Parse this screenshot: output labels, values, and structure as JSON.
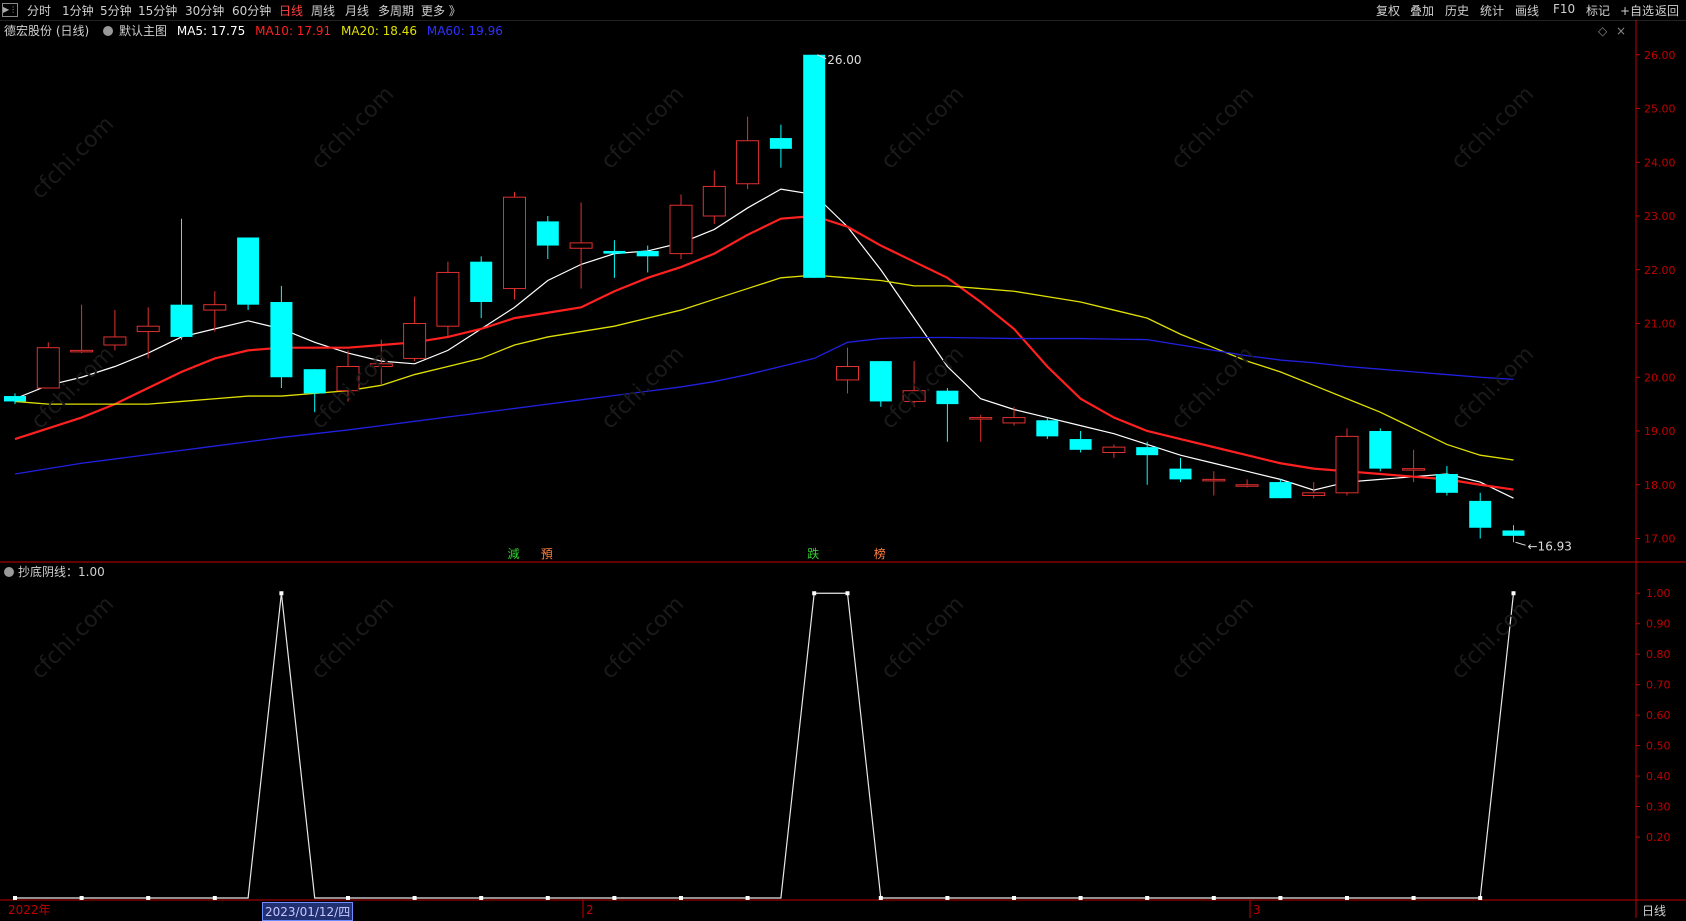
{
  "toolbar": {
    "left": [
      "分时",
      "1分钟",
      "5分钟",
      "15分钟",
      "30分钟",
      "60分钟",
      "日线",
      "周线",
      "月线",
      "多周期",
      "更多 》"
    ],
    "active": "日线",
    "right": [
      "复权",
      "叠加",
      "历史",
      "统计",
      "画线",
      "F10",
      "标记",
      "+自选",
      "返回"
    ]
  },
  "info": {
    "stock": "德宏股份 (日线)",
    "template": "默认主图",
    "ma5": "MA5: 17.75",
    "ma10": "MA10: 17.91",
    "ma20": "MA20: 18.46",
    "ma60": "MA60: 19.96"
  },
  "sub_indicator": {
    "label": "抄底阴线：1.00"
  },
  "x_labels": {
    "year": "2022年",
    "date_cursor": "2023/01/12/四",
    "m2": "2",
    "m3": "3"
  },
  "period": "日线",
  "colors": {
    "up": "#e03030",
    "down": "#00ffff",
    "ma5": "#ffffff",
    "ma10": "#ff2020",
    "ma20": "#e0e000",
    "ma60": "#2020e0",
    "axis": "#c00000"
  },
  "chart_data": [
    {
      "type": "candlestick",
      "title": "德宏股份 (日线)",
      "ylim": [
        16.6,
        26.2
      ],
      "y_ticks": [
        "26.00",
        "25.00",
        "24.00",
        "23.00",
        "22.00",
        "21.00",
        "20.00",
        "19.00",
        "18.00",
        "17.00"
      ],
      "max_label": "26.00",
      "min_label": "16.93",
      "candles": [
        {
          "o": 19.65,
          "c": 19.55,
          "h": 19.7,
          "l": 19.5
        },
        {
          "o": 19.8,
          "c": 20.55,
          "h": 20.65,
          "l": 19.8
        },
        {
          "o": 20.5,
          "c": 20.5,
          "h": 21.35,
          "l": 20.45
        },
        {
          "o": 20.6,
          "c": 20.75,
          "h": 21.25,
          "l": 20.5
        },
        {
          "o": 20.85,
          "c": 20.95,
          "h": 21.3,
          "l": 20.35
        },
        {
          "o": 21.35,
          "c": 20.75,
          "h": 22.95,
          "l": 20.7
        },
        {
          "o": 21.25,
          "c": 21.35,
          "h": 21.6,
          "l": 20.85
        },
        {
          "o": 22.6,
          "c": 21.35,
          "h": 22.6,
          "l": 21.25
        },
        {
          "o": 21.4,
          "c": 20.0,
          "h": 21.7,
          "l": 19.8
        },
        {
          "o": 20.15,
          "c": 19.7,
          "h": 20.15,
          "l": 19.35
        },
        {
          "o": 19.75,
          "c": 20.2,
          "h": 20.5,
          "l": 19.55
        },
        {
          "o": 20.2,
          "c": 20.25,
          "h": 20.7,
          "l": 19.85
        },
        {
          "o": 20.35,
          "c": 21.0,
          "h": 21.5,
          "l": 20.3
        },
        {
          "o": 20.95,
          "c": 21.95,
          "h": 22.15,
          "l": 20.75
        },
        {
          "o": 22.15,
          "c": 21.4,
          "h": 22.25,
          "l": 21.1
        },
        {
          "o": 21.65,
          "c": 23.35,
          "h": 23.45,
          "l": 21.45
        },
        {
          "o": 22.9,
          "c": 22.45,
          "h": 23.0,
          "l": 22.2
        },
        {
          "o": 22.4,
          "c": 22.5,
          "h": 23.25,
          "l": 21.65
        },
        {
          "o": 22.35,
          "c": 22.3,
          "h": 22.55,
          "l": 21.85
        },
        {
          "o": 22.35,
          "c": 22.25,
          "h": 22.45,
          "l": 21.95
        },
        {
          "o": 22.3,
          "c": 23.2,
          "h": 23.4,
          "l": 22.2
        },
        {
          "o": 23.0,
          "c": 23.55,
          "h": 23.85,
          "l": 22.85
        },
        {
          "o": 23.6,
          "c": 24.4,
          "h": 24.85,
          "l": 23.5
        },
        {
          "o": 24.45,
          "c": 24.25,
          "h": 24.7,
          "l": 23.9
        },
        {
          "o": 26.0,
          "c": 21.85,
          "h": 26.0,
          "l": 21.85
        },
        {
          "o": 19.95,
          "c": 20.2,
          "h": 20.55,
          "l": 19.7
        },
        {
          "o": 20.3,
          "c": 19.55,
          "h": 20.3,
          "l": 19.45
        },
        {
          "o": 19.55,
          "c": 19.75,
          "h": 20.3,
          "l": 19.45
        },
        {
          "o": 19.75,
          "c": 19.5,
          "h": 19.8,
          "l": 18.8
        },
        {
          "o": 19.25,
          "c": 19.25,
          "h": 19.3,
          "l": 18.8
        },
        {
          "o": 19.15,
          "c": 19.25,
          "h": 19.45,
          "l": 19.1
        },
        {
          "o": 19.2,
          "c": 18.9,
          "h": 19.25,
          "l": 18.85
        },
        {
          "o": 18.85,
          "c": 18.65,
          "h": 19.0,
          "l": 18.6
        },
        {
          "o": 18.6,
          "c": 18.7,
          "h": 18.75,
          "l": 18.5
        },
        {
          "o": 18.7,
          "c": 18.55,
          "h": 18.8,
          "l": 18.0
        },
        {
          "o": 18.3,
          "c": 18.1,
          "h": 18.5,
          "l": 18.05
        },
        {
          "o": 18.1,
          "c": 18.1,
          "h": 18.25,
          "l": 17.8
        },
        {
          "o": 18.0,
          "c": 18.0,
          "h": 18.1,
          "l": 17.95
        },
        {
          "o": 18.05,
          "c": 17.75,
          "h": 18.1,
          "l": 17.75
        },
        {
          "o": 17.8,
          "c": 17.85,
          "h": 18.05,
          "l": 17.75
        },
        {
          "o": 17.85,
          "c": 18.9,
          "h": 19.05,
          "l": 17.8
        },
        {
          "o": 19.0,
          "c": 18.3,
          "h": 19.05,
          "l": 18.25
        },
        {
          "o": 18.3,
          "c": 18.3,
          "h": 18.65,
          "l": 18.05
        },
        {
          "o": 18.2,
          "c": 17.85,
          "h": 18.35,
          "l": 17.8
        },
        {
          "o": 17.7,
          "c": 17.2,
          "h": 17.85,
          "l": 17.0
        },
        {
          "o": 17.15,
          "c": 17.05,
          "h": 17.25,
          "l": 16.93
        }
      ],
      "series": [
        {
          "name": "MA5",
          "values": [
            19.6,
            19.85,
            20.0,
            20.2,
            20.45,
            20.75,
            20.9,
            21.05,
            20.9,
            20.65,
            20.45,
            20.3,
            20.25,
            20.5,
            20.9,
            21.3,
            21.8,
            22.1,
            22.3,
            22.35,
            22.5,
            22.75,
            23.15,
            23.5,
            23.4,
            22.8,
            22.0,
            21.1,
            20.2,
            19.6,
            19.4,
            19.25,
            19.1,
            18.95,
            18.75,
            18.55,
            18.4,
            18.25,
            18.1,
            17.9,
            18.05,
            18.1,
            18.15,
            18.2,
            18.05,
            17.75
          ]
        },
        {
          "name": "MA10",
          "values": [
            18.85,
            19.05,
            19.25,
            19.5,
            19.8,
            20.1,
            20.35,
            20.5,
            20.55,
            20.55,
            20.55,
            20.6,
            20.65,
            20.75,
            20.9,
            21.1,
            21.2,
            21.3,
            21.6,
            21.85,
            22.05,
            22.3,
            22.65,
            22.95,
            23.0,
            22.8,
            22.45,
            22.15,
            21.85,
            21.4,
            20.9,
            20.2,
            19.6,
            19.25,
            19.0,
            18.85,
            18.7,
            18.55,
            18.4,
            18.3,
            18.25,
            18.2,
            18.15,
            18.1,
            18.0,
            17.91
          ]
        },
        {
          "name": "MA20",
          "values": [
            19.55,
            19.5,
            19.5,
            19.5,
            19.5,
            19.55,
            19.6,
            19.65,
            19.65,
            19.7,
            19.75,
            19.85,
            20.05,
            20.2,
            20.35,
            20.6,
            20.75,
            20.85,
            20.95,
            21.1,
            21.25,
            21.45,
            21.65,
            21.85,
            21.9,
            21.85,
            21.8,
            21.7,
            21.7,
            21.65,
            21.6,
            21.5,
            21.4,
            21.25,
            21.1,
            20.8,
            20.55,
            20.3,
            20.1,
            19.85,
            19.6,
            19.35,
            19.05,
            18.75,
            18.55,
            18.46
          ]
        },
        {
          "name": "MA60",
          "values": [
            18.2,
            18.3,
            18.4,
            18.48,
            18.56,
            18.64,
            18.72,
            18.8,
            18.88,
            18.95,
            19.02,
            19.1,
            19.18,
            19.26,
            19.34,
            19.42,
            19.5,
            19.58,
            19.66,
            19.74,
            19.82,
            19.92,
            20.05,
            20.2,
            20.35,
            20.65,
            20.72,
            20.74,
            20.74,
            20.73,
            20.72,
            20.72,
            20.72,
            20.71,
            20.7,
            20.6,
            20.5,
            20.4,
            20.32,
            20.27,
            20.2,
            20.15,
            20.1,
            20.05,
            20.0,
            19.96
          ]
        }
      ],
      "signals": [
        {
          "i": 15,
          "label": "減",
          "color": "#30d030"
        },
        {
          "i": 16,
          "label": "預",
          "color": "#ff8040"
        },
        {
          "i": 24,
          "label": "跌",
          "color": "#30d030"
        },
        {
          "i": 26,
          "label": "榜",
          "color": "#ff8040"
        }
      ]
    },
    {
      "type": "line",
      "title": "抄底阴线：1.00",
      "ylim": [
        0,
        1.05
      ],
      "y_ticks": [
        "1.00",
        "0.90",
        "0.80",
        "0.70",
        "0.60",
        "0.50",
        "0.40",
        "0.30",
        "0.20"
      ],
      "series": [
        {
          "name": "抄底阴线",
          "values": [
            0,
            0,
            0,
            0,
            0,
            0,
            0,
            0,
            1,
            0,
            0,
            0,
            0,
            0,
            0,
            0,
            0,
            0,
            0,
            0,
            0,
            0,
            0,
            0,
            1,
            1,
            0,
            0,
            0,
            0,
            0,
            0,
            0,
            0,
            0,
            0,
            0,
            0,
            0,
            0,
            0,
            0,
            0,
            0,
            0,
            1
          ]
        }
      ]
    }
  ]
}
